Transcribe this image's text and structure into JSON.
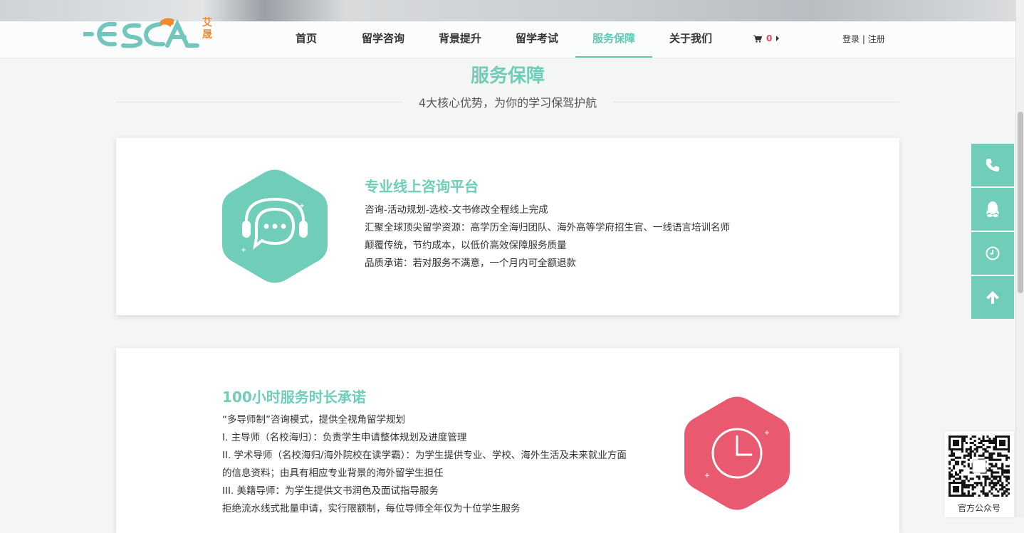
{
  "header": {
    "logo_cn": "艾晟",
    "nav": [
      "首页",
      "留学咨询",
      "背景提升",
      "留学考试",
      "服务保障",
      "关于我们"
    ],
    "active_index": 4,
    "cart_count": "0",
    "login": "登录",
    "separator": "|",
    "register": "注册"
  },
  "section": {
    "title": "服务保障",
    "subtitle": "4大核心优势，为你的学习保驾护航"
  },
  "cards": [
    {
      "title": "专业线上咨询平台",
      "icon": "chat-headset-icon",
      "color": "#6fcdb9",
      "lines": [
        "咨询-活动规划-选校-文书修改全程线上完成",
        "汇聚全球顶尖留学资源：高学历全海归团队、海外高等学府招生官、一线语言培训名师",
        "颠覆传统，节约成本，以低价高效保障服务质量",
        "品质承诺：若对服务不满意，一个月内可全额退款"
      ]
    },
    {
      "title": "100小时服务时长承诺",
      "icon": "clock-icon",
      "color": "#e95a70",
      "lines": [
        "“多导师制”咨询模式，提供全视角留学规划",
        "I. 主导师（名校海归）：负责学生申请整体规划及进度管理",
        "II. 学术导师（名校海归/海外院校在读学霸）：为学生提供专业、学校、海外生活及未来就业方面",
        "的信息资料；由具有相应专业背景的海外留学生担任",
        "III. 美籍导师：为学生提供文书润色及面试指导服务",
        "拒绝流水线式批量申请，实行限额制，每位导师全年仅为十位学生服务"
      ]
    }
  ],
  "float_bar": [
    "phone-icon",
    "qq-icon",
    "clock-icon",
    "arrow-up-icon"
  ],
  "qr": {
    "caption": "官方公众号"
  }
}
